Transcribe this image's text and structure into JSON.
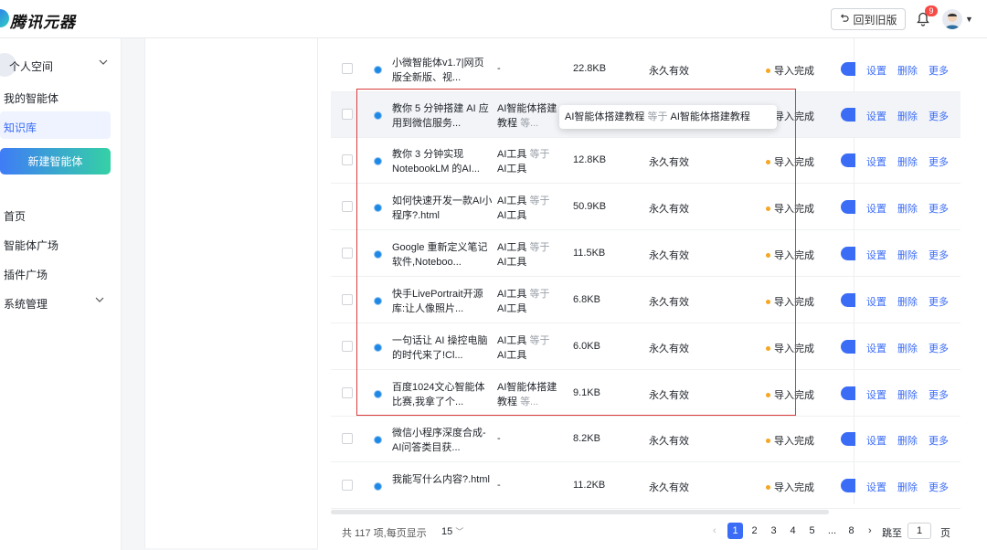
{
  "header": {
    "logo_text": "腾讯元器",
    "old_version_label": "回到旧版",
    "notification_count": "9"
  },
  "sidebar": {
    "workspace_label": "个人空间",
    "items": [
      {
        "label": "我的智能体"
      },
      {
        "label": "知识库"
      }
    ],
    "new_agent_label": "新建智能体",
    "nav": [
      {
        "label": "首页"
      },
      {
        "label": "智能体广场"
      },
      {
        "label": "插件广场"
      },
      {
        "label": "系统管理"
      }
    ]
  },
  "table": {
    "rows": [
      {
        "name": "小微智能体v1.7|网页版全新版、视...",
        "tag": "-",
        "tag_eq": "",
        "size": "22.8KB",
        "validity": "永久有效",
        "status": "导入完成"
      },
      {
        "name": "教你 5 分钟搭建 AI 应用到微信服务...",
        "tag": "AI智能体搭建教程",
        "tag_eq": "等...",
        "size": "",
        "validity": "",
        "status": "导入完成"
      },
      {
        "name": "教你 3 分钟实现 NotebookLM 的AI...",
        "tag": "AI工具",
        "tag_eq": "等于",
        "tag2": "AI工具",
        "size": "12.8KB",
        "validity": "永久有效",
        "status": "导入完成"
      },
      {
        "name": "如何快速开发一款AI小程序?.html",
        "tag": "AI工具",
        "tag_eq": "等于",
        "tag2": "AI工具",
        "size": "50.9KB",
        "validity": "永久有效",
        "status": "导入完成"
      },
      {
        "name": "Google 重新定义笔记软件,Noteboo...",
        "tag": "AI工具",
        "tag_eq": "等于",
        "tag2": "AI工具",
        "size": "11.5KB",
        "validity": "永久有效",
        "status": "导入完成"
      },
      {
        "name": "快手LivePortrait开源库:让人像照片...",
        "tag": "AI工具",
        "tag_eq": "等于",
        "tag2": "AI工具",
        "size": "6.8KB",
        "validity": "永久有效",
        "status": "导入完成"
      },
      {
        "name": "一句话让 AI 操控电脑的时代来了!Cl...",
        "tag": "AI工具",
        "tag_eq": "等于",
        "tag2": "AI工具",
        "size": "6.0KB",
        "validity": "永久有效",
        "status": "导入完成"
      },
      {
        "name": "百度1024文心智能体比赛,我拿了个...",
        "tag": "AI智能体搭建教程",
        "tag_eq": "等...",
        "size": "9.1KB",
        "validity": "永久有效",
        "status": "导入完成"
      },
      {
        "name": "微信小程序深度合成-AI问答类目获...",
        "tag": "-",
        "tag_eq": "",
        "size": "8.2KB",
        "validity": "永久有效",
        "status": "导入完成"
      },
      {
        "name": "我能写什么内容?.html",
        "tag": "-",
        "tag_eq": "",
        "size": "11.2KB",
        "validity": "永久有效",
        "status": "导入完成"
      }
    ],
    "actions": {
      "settings": "设置",
      "delete": "删除",
      "more": "更多"
    },
    "tooltip": {
      "left": "AI智能体搭建教程",
      "eq": "等于",
      "right": "AI智能体搭建教程"
    }
  },
  "pagination": {
    "total": "共 117 项,每页显示",
    "page_size": "15",
    "pages": [
      "1",
      "2",
      "3",
      "4",
      "5",
      "...",
      "8"
    ],
    "jump_label": "跳至",
    "jump_value": "1",
    "page_suffix": "页"
  }
}
